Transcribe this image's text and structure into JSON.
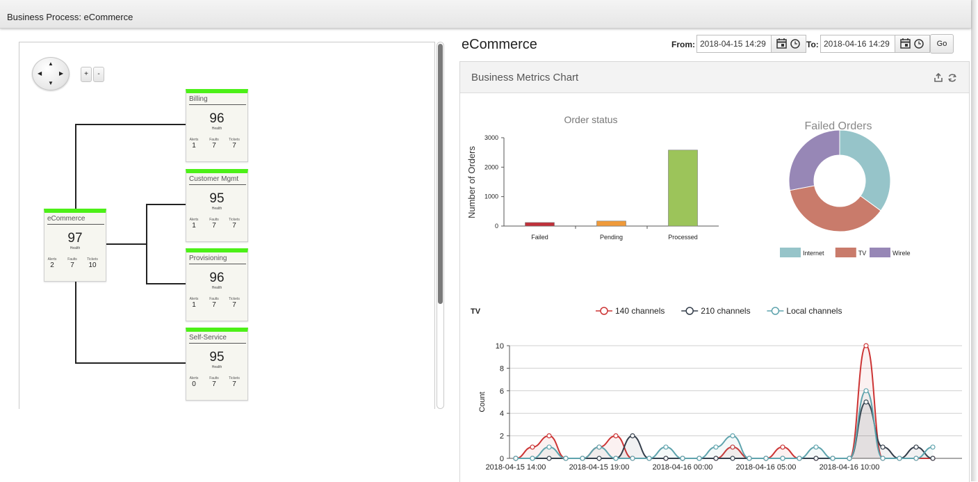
{
  "window": {
    "title": "Business Process: eCommerce"
  },
  "topology": {
    "pan_arrows": {
      "up": "▲",
      "down": "▼",
      "left": "◀",
      "right": "▶"
    },
    "zoom_in": "+",
    "zoom_out": "-",
    "metric_labels": {
      "alerts": "Alerts",
      "faults": "Faults",
      "tickets": "Tickets",
      "health": "Health"
    },
    "nodes": [
      {
        "name": "eCommerce",
        "health": "97",
        "alerts": "2",
        "faults": "7",
        "tickets": "10"
      },
      {
        "name": "Billing",
        "health": "96",
        "alerts": "1",
        "faults": "7",
        "tickets": "7"
      },
      {
        "name": "Customer Mgmt",
        "health": "95",
        "alerts": "1",
        "faults": "7",
        "tickets": "7"
      },
      {
        "name": "Provisioning",
        "health": "96",
        "alerts": "1",
        "faults": "7",
        "tickets": "7"
      },
      {
        "name": "Self-Service",
        "health": "95",
        "alerts": "0",
        "faults": "7",
        "tickets": "7"
      }
    ],
    "status_color": "#4cf017"
  },
  "header": {
    "title": "eCommerce",
    "from_label": "From:",
    "from_value": "2018-04-15 14:29",
    "to_label": "To:",
    "to_value": "2018-04-16 14:29",
    "go_label": "Go"
  },
  "card": {
    "title": "Business Metrics Chart",
    "export_icon": "export-icon",
    "refresh_icon": "refresh-icon"
  },
  "chart_data": [
    {
      "type": "bar",
      "title": "Order status",
      "xlabel": "",
      "ylabel": "Number of Orders",
      "categories": [
        "Failed",
        "Pending",
        "Processed"
      ],
      "values": [
        120,
        170,
        2580
      ],
      "ylim": [
        0,
        3000
      ],
      "yticks": [
        0,
        1000,
        2000,
        3000
      ],
      "colors": [
        "#c0303a",
        "#ef9a3a",
        "#9cc45a"
      ]
    },
    {
      "type": "pie",
      "title": "Failed Orders",
      "labels": [
        "Internet",
        "TV",
        "Wireless"
      ],
      "values": [
        35,
        37,
        28
      ],
      "colors": [
        "#96c4c9",
        "#c97b6b",
        "#9787b6"
      ],
      "legend": "bottom"
    },
    {
      "type": "line",
      "title": "TV",
      "ylabel": "Count",
      "xlabel": "",
      "ylim": [
        0,
        10
      ],
      "yticks": [
        0,
        2,
        4,
        6,
        8,
        10
      ],
      "x_ticks": [
        "2018-04-15 14:00",
        "2018-04-15 19:00",
        "2018-04-16 00:00",
        "2018-04-16 05:00",
        "2018-04-16 10:00"
      ],
      "x_hours": [
        14,
        15,
        16,
        17,
        18,
        19,
        20,
        21,
        22,
        23,
        24,
        25,
        26,
        27,
        28,
        29,
        30,
        31,
        32,
        33,
        34,
        35,
        36,
        37,
        38,
        39
      ],
      "series": [
        {
          "name": "140 channels",
          "color": "#cc3333",
          "values": [
            0,
            1,
            2,
            0,
            0,
            1,
            2,
            0,
            0,
            0,
            0,
            0,
            0,
            1,
            0,
            0,
            1,
            0,
            0,
            0,
            0,
            10,
            0,
            0,
            0,
            0
          ]
        },
        {
          "name": "210 channels",
          "color": "#333d4a",
          "values": [
            0,
            0,
            0,
            0,
            0,
            0,
            0,
            2,
            0,
            0,
            0,
            0,
            0,
            0,
            0,
            0,
            0,
            0,
            0,
            0,
            0,
            5,
            1,
            0,
            1,
            0
          ]
        },
        {
          "name": "Local channels",
          "color": "#5ea3ad",
          "values": [
            0,
            0,
            1,
            0,
            0,
            1,
            0,
            0,
            0,
            1,
            0,
            0,
            1,
            2,
            0,
            0,
            0,
            0,
            1,
            0,
            0,
            6,
            0,
            0,
            0,
            1
          ]
        }
      ],
      "legend": "top"
    }
  ]
}
